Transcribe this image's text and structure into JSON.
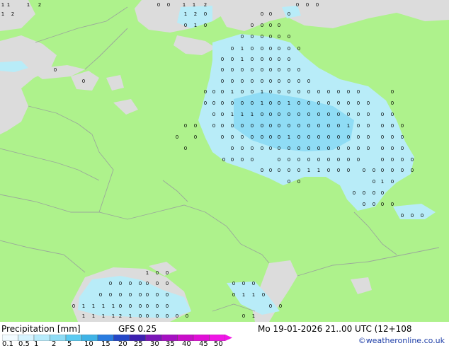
{
  "footer": {
    "title": "Precipitation [mm]",
    "model": "GFS 0.25",
    "valid_time": "Mo 19-01-2026 21..00 UTC (12+108",
    "credit": "©weatheronline.co.uk"
  },
  "scale": {
    "labels": [
      "0.1",
      "0.5",
      "1",
      "2",
      "5",
      "10",
      "15",
      "20",
      "25",
      "30",
      "35",
      "40",
      "45",
      "50"
    ],
    "colors": [
      "#f2fbff",
      "#d6f4ff",
      "#b7ebfb",
      "#8fdcf5",
      "#5ccbf2",
      "#3fb3e6",
      "#2a7ce0",
      "#2447c7",
      "#3c1fb0",
      "#7a17b8",
      "#a510c2",
      "#c90ec9",
      "#e00fd6",
      "#f017e6"
    ]
  },
  "colors": {
    "land": "#aef28c",
    "sea": "#dcdcdc",
    "precip_light": "#b8ecf8",
    "precip_medium": "#8fdcf5",
    "border": "#9aa89a"
  },
  "map": {
    "marker_value_0": "0",
    "marker_value_1": "1",
    "marker_value_2": "2"
  }
}
